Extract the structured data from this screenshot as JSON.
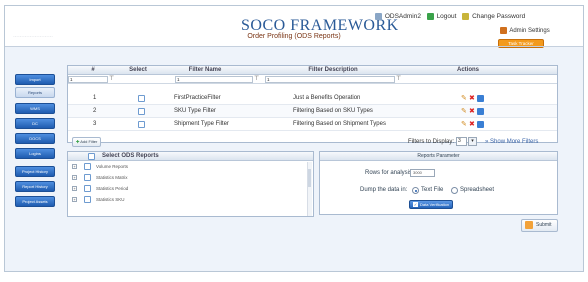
{
  "app": {
    "brand_a": "S",
    "brand_b": "OCO ",
    "brand_c": "F",
    "brand_d": "RAMEWORK",
    "page_title": "Order Profiling (ODS Reports)",
    "faint_text": "……………………"
  },
  "topbar": {
    "user": "ODSAdmin2",
    "logout": "Logout",
    "change_password": "Change Password",
    "admin_settings": "Admin Settings",
    "tracker_button": "Task Tracker"
  },
  "colors": {
    "accent": "#1f5cb0",
    "brand": "#2a5a97",
    "title": "#7a3515",
    "orange": "#f39a1d"
  },
  "sidebar": {
    "items": [
      {
        "label": "Import",
        "active": true
      },
      {
        "label": "Reports",
        "active": false
      },
      {
        "label": "WMS",
        "active": true
      },
      {
        "label": "DC",
        "active": true
      },
      {
        "label": "DOCS",
        "active": true
      },
      {
        "label": "Logins",
        "active": true
      },
      {
        "label": "Project History",
        "active": true
      },
      {
        "label": "Report History",
        "active": true
      },
      {
        "label": "Project Assets",
        "active": true
      }
    ]
  },
  "grid": {
    "headers": {
      "num": "#",
      "select": "Select",
      "name": "Filter Name",
      "desc": "Filter Description",
      "actions": "Actions"
    },
    "filter_values": {
      "num": "1",
      "name": "1",
      "desc": "1"
    },
    "rows": [
      {
        "num": "1",
        "name": "FirstPracticeFilter",
        "desc": "Just a Benefits Operation"
      },
      {
        "num": "2",
        "name": "SKU Type Filter",
        "desc": "Filtering Based on SKU Types"
      },
      {
        "num": "3",
        "name": "Shipment Type Filter",
        "desc": "Filtering Based on Shipment Types"
      }
    ],
    "add_button": "Add Filter",
    "filters_label": "Filters to Display:",
    "filters_count": "3",
    "show_more": "Show More Filters"
  },
  "reports": {
    "header": "Select ODS Reports",
    "items": [
      "Volume Reports",
      "Statistics Matrix",
      "Statistics Period",
      "Statistics SKU"
    ]
  },
  "params": {
    "header": "Reports Parameter",
    "rows_label": "Rows for analysis:",
    "rows_value": "3000",
    "dump_label": "Dump the data in:",
    "opt_text": "Text File",
    "opt_sheet": "Spreadsheet",
    "include_button": "Data Verification"
  },
  "submit": "Submit"
}
